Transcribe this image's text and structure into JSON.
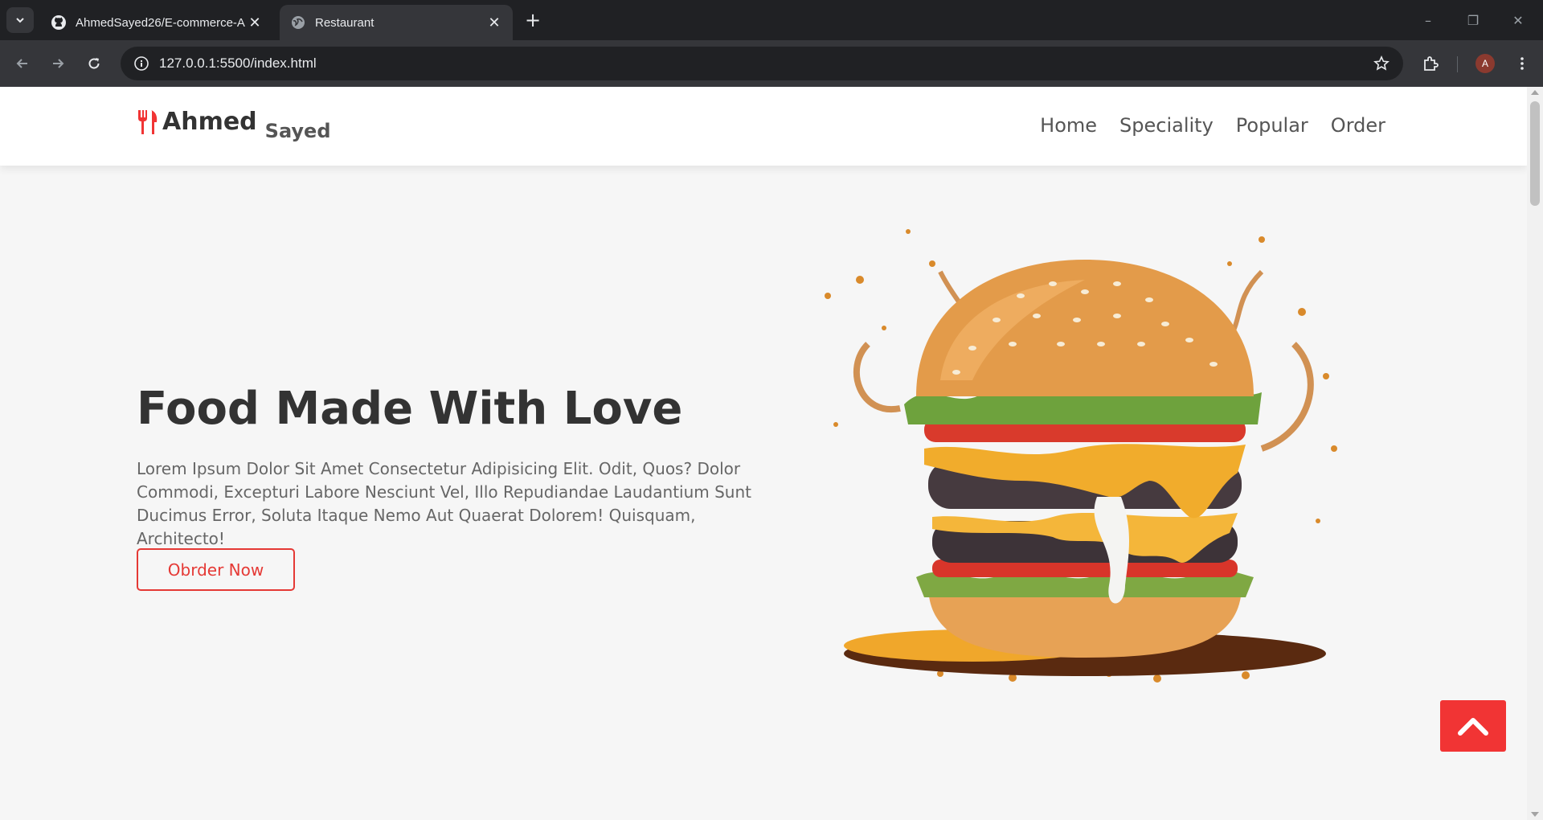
{
  "browser": {
    "tabs": [
      {
        "title": "AhmedSayed26/E-commerce-A",
        "icon": "github-icon",
        "active": false
      },
      {
        "title": "Restaurant",
        "icon": "globe-icon",
        "active": true
      }
    ],
    "url": "127.0.0.1:5500/index.html",
    "profile_initial": "A"
  },
  "site": {
    "logo": {
      "main": "Ahmed",
      "sub": "Sayed",
      "icon": "utensils-icon"
    },
    "nav": [
      {
        "label": "Home"
      },
      {
        "label": "Speciality"
      },
      {
        "label": "Popular"
      },
      {
        "label": "Order"
      }
    ],
    "hero": {
      "title": "Food Made With Love",
      "description": "Lorem Ipsum Dolor Sit Amet Consectetur Adipisicing Elit. Odit, Quos? Dolor Commodi, Excepturi Labore Nesciunt Vel, Illo Repudiandae Laudantium Sunt Ducimus Error, Soluta Itaque Nemo Aut Quaerat Dolorem! Quisquam, Architecto!",
      "button_label": "Obrder Now",
      "image": "burger-image"
    },
    "scroll_top_icon": "chevron-up-icon"
  },
  "colors": {
    "accent": "#f13434",
    "chrome_dark": "#202124",
    "chrome_mid": "#35363a",
    "page_bg": "#f6f6f6"
  }
}
